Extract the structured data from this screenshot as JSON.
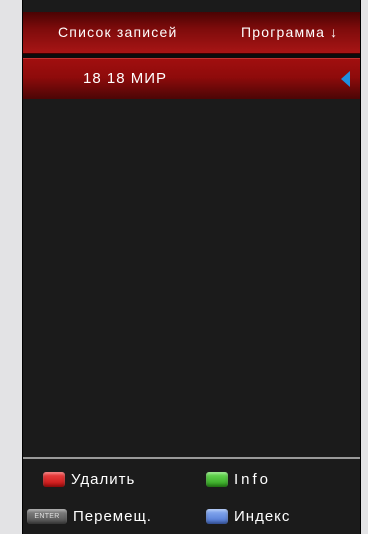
{
  "header": {
    "title": "Список записей",
    "sort_label": "Программа",
    "sort_arrow": "↓"
  },
  "list": {
    "items": [
      {
        "label": "18 18 МИР",
        "selected": true
      }
    ]
  },
  "footer": {
    "actions": [
      {
        "key": "red",
        "label": "Удалить"
      },
      {
        "key": "green",
        "label": "Info"
      },
      {
        "key": "enter",
        "key_text": "ENTER",
        "label": "Перемещ."
      },
      {
        "key": "blue",
        "label": "Индекс"
      }
    ]
  },
  "colors": {
    "accent_red": "#8f0b0b",
    "pointer_blue": "#1e8fe0",
    "background": "#1b1b1b"
  }
}
